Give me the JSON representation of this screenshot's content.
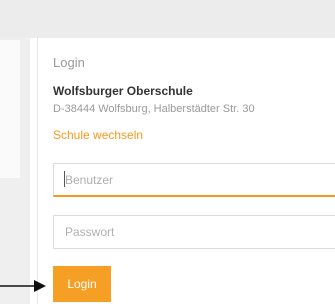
{
  "login_card": {
    "title": "Login",
    "school_name": "Wolfsburger Oberschule",
    "school_address": "D-38444 Wolfsburg, Halberstädter Str. 30",
    "switch_school_label": "Schule wechseln",
    "username_placeholder": "Benutzer",
    "password_placeholder": "Passwort",
    "login_button_label": "Login"
  },
  "colors": {
    "accent": "#f39a1c",
    "button": "#f5a025"
  }
}
